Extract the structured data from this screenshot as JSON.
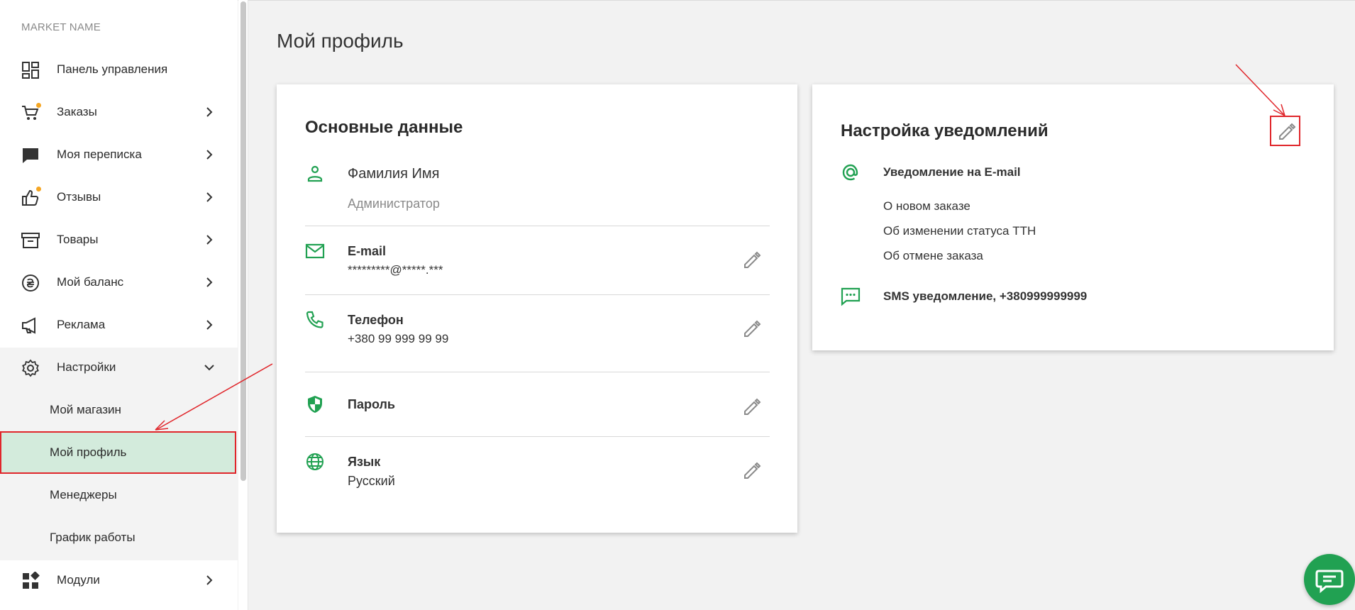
{
  "sidebar": {
    "market_name": "MARKET NAME",
    "items": [
      {
        "label": "Панель управления"
      },
      {
        "label": "Заказы"
      },
      {
        "label": "Моя переписка"
      },
      {
        "label": "Отзывы"
      },
      {
        "label": "Товары"
      },
      {
        "label": "Мой баланс"
      },
      {
        "label": "Реклама"
      },
      {
        "label": "Настройки"
      },
      {
        "label": "Модули"
      }
    ],
    "settings_sub": [
      {
        "label": "Мой магазин"
      },
      {
        "label": "Мой профиль"
      },
      {
        "label": "Менеджеры"
      },
      {
        "label": "График работы"
      }
    ]
  },
  "page": {
    "title": "Мой профиль"
  },
  "basic": {
    "title": "Основные данные",
    "name": "Фамилия Имя",
    "role": "Администратор",
    "email_label": "E-mail",
    "email_value": "*********@*****.***",
    "phone_label": "Телефон",
    "phone_value": "+380 99 999 99 99",
    "password_label": "Пароль",
    "language_label": "Язык",
    "language_value": "Русский"
  },
  "notifications": {
    "title": "Настройка уведомлений",
    "email_title": "Уведомление на E-mail",
    "email_items": [
      "О новом заказе",
      "Об изменении статуса ТТН",
      "Об отмене заказа"
    ],
    "sms_title": "SMS уведомление, +380999999999"
  },
  "colors": {
    "accent": "#21a152",
    "highlight": "#e0262b",
    "badge": "#f5a623",
    "active_bg": "#d3ebdc"
  }
}
